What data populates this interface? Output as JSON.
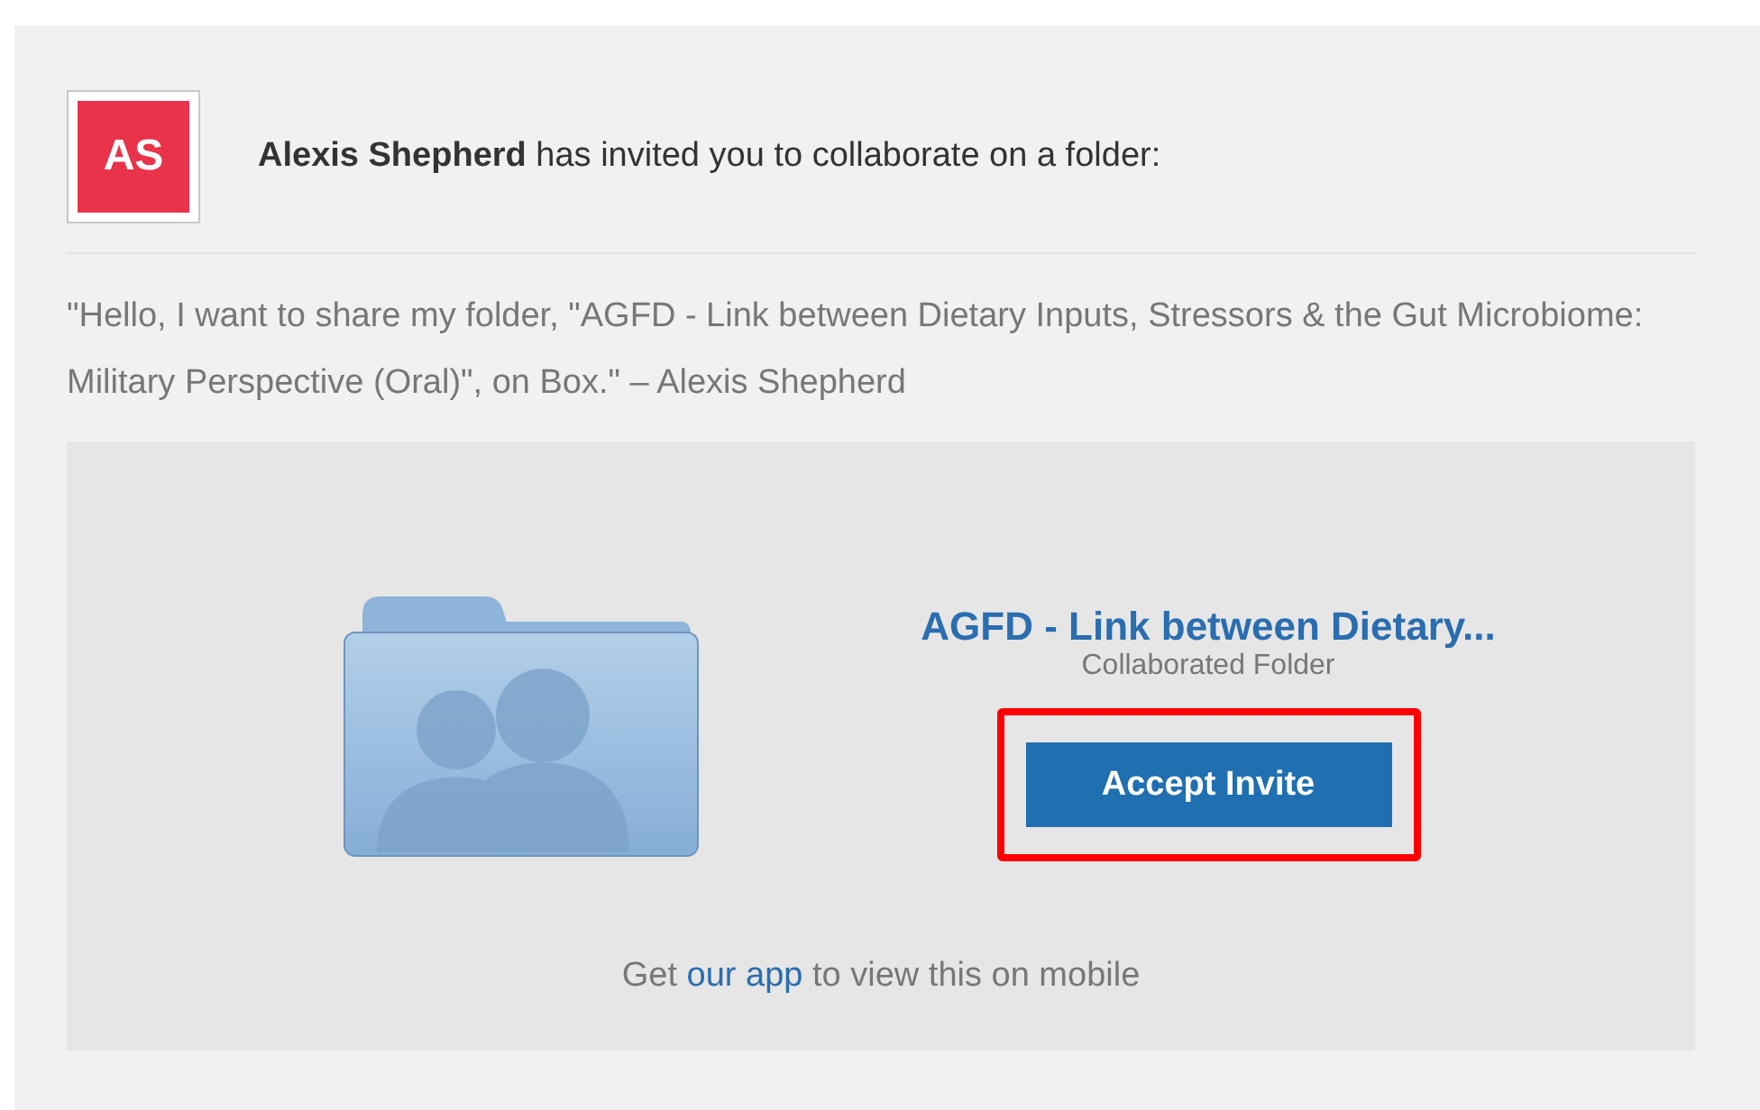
{
  "avatar": {
    "initials": "AS",
    "color": "#e8334a"
  },
  "header": "**Alexis Shepherd** has invited you to collaborate on a folder:",
  "message": "\"Hello, I want to share my folder, \"AGFD - Link between Dietary Inputs, Stressors & the Gut Microbiome: Military Perspective (Oral)\", on Box.\" – Alexis Shepherd",
  "folder": {
    "name": "AGFD - Link between Dietary...",
    "type": "Collaborated Folder"
  },
  "accept_button": {
    "label": "Accept Invite",
    "highlighted": true
  },
  "footer": {
    "before": "Get",
    "link": "our app",
    "after": "to view this on mobile"
  }
}
